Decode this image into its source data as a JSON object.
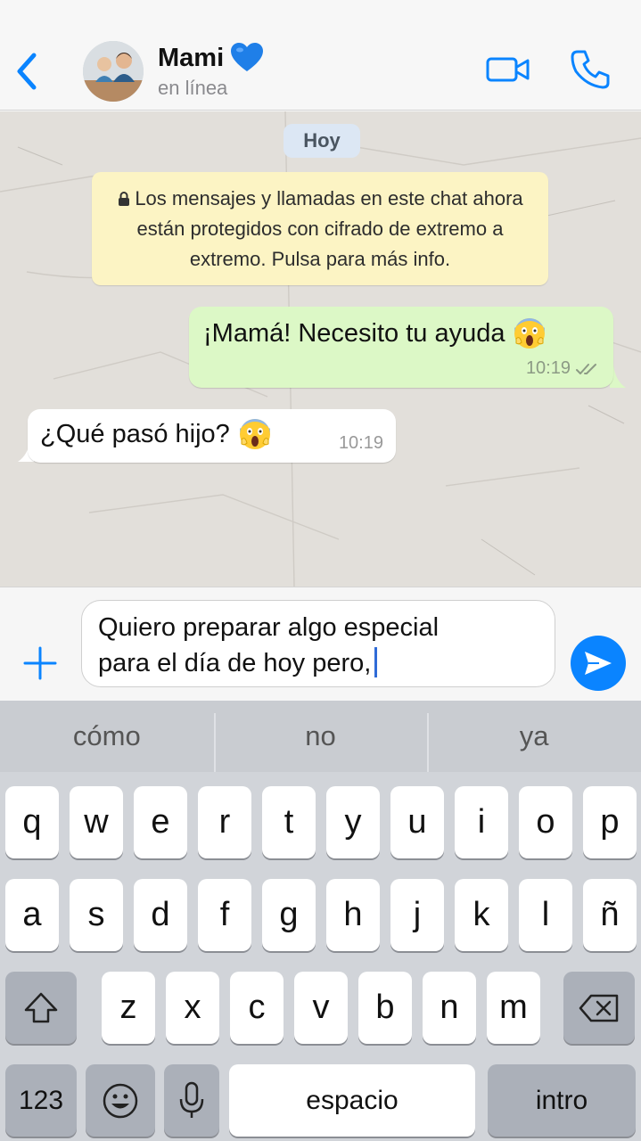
{
  "header": {
    "name": "Mami",
    "status": "en línea",
    "name_emoji": "blue-heart-icon"
  },
  "chat": {
    "date_label": "Hoy",
    "encryption_notice": "Los mensajes y llamadas en este chat ahora están protegidos con cifrado de extremo a extremo. Pulsa para más info.",
    "messages": [
      {
        "direction": "out",
        "text": "¡Mamá! Necesito tu ayuda",
        "time": "10:19",
        "emoji": "screaming-face-icon",
        "status": "delivered"
      },
      {
        "direction": "in",
        "text": "¿Qué pasó hijo?",
        "time": "10:19",
        "emoji": "screaming-face-icon"
      }
    ]
  },
  "composer": {
    "line1": "Quiero preparar algo especial",
    "line2": "para el día de hoy pero,"
  },
  "keyboard": {
    "suggestions": [
      "cómo",
      "no",
      "ya"
    ],
    "row1": [
      "q",
      "w",
      "e",
      "r",
      "t",
      "y",
      "u",
      "i",
      "o",
      "p"
    ],
    "row2": [
      "a",
      "s",
      "d",
      "f",
      "g",
      "h",
      "j",
      "k",
      "l",
      "ñ"
    ],
    "row3": [
      "z",
      "x",
      "c",
      "v",
      "b",
      "n",
      "m"
    ],
    "numbers_key": "123",
    "space_key": "espacio",
    "return_key": "intro"
  },
  "colors": {
    "accent": "#0a84ff",
    "outgoing_bubble": "#dcf8c6",
    "incoming_bubble": "#ffffff",
    "notice_bg": "#fcf4c4"
  }
}
